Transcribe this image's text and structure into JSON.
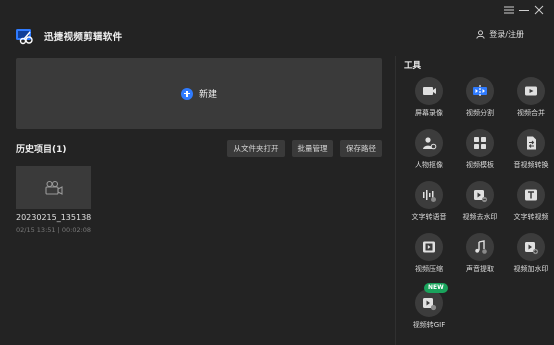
{
  "app": {
    "title": "迅捷视频剪辑软件",
    "login_label": "登录/注册"
  },
  "main": {
    "new_label": "新建",
    "history_title": "历史项目(1)",
    "buttons": {
      "open_folder": "从文件夹打开",
      "batch_manage": "批量管理",
      "save_path": "保存路径"
    },
    "project": {
      "name": "20230215_135138",
      "meta": "02/15 13:51 | 00:02:08"
    }
  },
  "tools": {
    "title": "工具",
    "items": [
      {
        "label": "屏幕录像",
        "icon": "screen-record-icon"
      },
      {
        "label": "视频分割",
        "icon": "video-split-icon"
      },
      {
        "label": "视频合并",
        "icon": "video-merge-icon"
      },
      {
        "label": "人物抠像",
        "icon": "person-cutout-icon"
      },
      {
        "label": "视频模板",
        "icon": "video-template-icon"
      },
      {
        "label": "音视频转换",
        "icon": "av-convert-icon"
      },
      {
        "label": "文字转语音",
        "icon": "text-to-speech-icon"
      },
      {
        "label": "视频去水印",
        "icon": "remove-watermark-icon"
      },
      {
        "label": "文字转视频",
        "icon": "text-to-video-icon"
      },
      {
        "label": "视频压缩",
        "icon": "video-compress-icon"
      },
      {
        "label": "声音提取",
        "icon": "audio-extract-icon"
      },
      {
        "label": "视频加水印",
        "icon": "add-watermark-icon"
      },
      {
        "label": "视频转GIF",
        "icon": "video-to-gif-icon",
        "badge": "NEW"
      }
    ]
  },
  "colors": {
    "background": "#232323",
    "panel": "#3a3a3a",
    "accent": "#2f7bff",
    "badge": "#1aa35c"
  }
}
